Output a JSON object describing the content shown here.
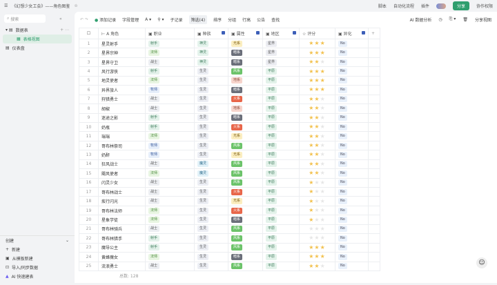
{
  "title": "《幻想少女工会》——角色图鉴",
  "topbar": {
    "script": "脚本",
    "automation": "自动化流程",
    "plugin": "插件",
    "share": "分享",
    "permission": "协作权限"
  },
  "sidebar": {
    "search_placeholder": "搜索",
    "group": "数据表",
    "items": [
      "表格视图",
      "仪表盘"
    ],
    "create": "创建",
    "create_items": [
      "新建",
      "从模板新建",
      "导入/同步数据",
      "AI 快速建表"
    ]
  },
  "toolbar": {
    "add": "添加记录",
    "fields": "字段管理",
    "subrecord": "子记录",
    "filter": "筛选(4)",
    "sort": "排序",
    "group": "分组",
    "row_height": "行高",
    "notice": "公告",
    "find": "查找",
    "ai": "AI 数据分析",
    "share_view": "分享视图"
  },
  "columns": [
    "角色",
    "职业",
    "种族",
    "属性",
    "地区",
    "评分",
    "异化"
  ],
  "colors": {
    "accent": "#2f9e6e",
    "star": "#f2c14e"
  },
  "rows": [
    [
      "星灵射手",
      "射手",
      "神灵",
      "光系",
      "星界",
      3,
      "No"
    ],
    [
      "星界宗神",
      "法师",
      "神灵",
      "暗系",
      "星界",
      3,
      "No"
    ],
    [
      "星界守卫",
      "战士",
      "神灵",
      "暗系",
      "星界",
      2,
      "No"
    ],
    [
      "风行游侠",
      "射手",
      "生灵",
      "风系",
      "平原",
      3,
      "No"
    ],
    [
      "地灵使者",
      "法师",
      "生灵",
      "地系",
      "平原",
      3,
      "No"
    ],
    [
      "异界旅人",
      "牧师",
      "生灵",
      "暗系",
      "平原",
      3,
      "No"
    ],
    [
      "狩猎勇士",
      "战士",
      "生灵",
      "火系",
      "平原",
      2,
      "No"
    ],
    [
      "胡椒",
      "战士",
      "生灵",
      "地系",
      "平原",
      2,
      "No"
    ],
    [
      "迷途之影",
      "射手",
      "生灵",
      "暗系",
      "平原",
      2,
      "No"
    ],
    [
      "奶瓶",
      "射手",
      "生灵",
      "火系",
      "平原",
      2,
      "No"
    ],
    [
      "瑞瑞",
      "法师",
      "生灵",
      "光系",
      "平原",
      2,
      "No"
    ],
    [
      "哥布林祭司",
      "牧师",
      "生灵",
      "风系",
      "平原",
      2,
      "No"
    ],
    [
      "奶酐",
      "牧师",
      "生灵",
      "光系",
      "平原",
      2,
      "No"
    ],
    [
      "狂风战士",
      "战士",
      "魔灵",
      "风系",
      "平原",
      2,
      "No"
    ],
    [
      "飓风使者",
      "法师",
      "魔灵",
      "风系",
      "平原",
      2,
      "No"
    ],
    [
      "闪灵少女",
      "战士",
      "生灵",
      "风系",
      "平原",
      1,
      "No"
    ],
    [
      "哥布林战士",
      "战士",
      "生灵",
      "火系",
      "平原",
      1,
      "No"
    ],
    [
      "疾行闪光",
      "战士",
      "生灵",
      "光系",
      "平原",
      1,
      "No"
    ],
    [
      "哥布林法师",
      "法师",
      "生灵",
      "火系",
      "平原",
      1,
      "No"
    ],
    [
      "星象学徒",
      "法师",
      "生灵",
      "暗系",
      "平原",
      1,
      "No"
    ],
    [
      "哥布林骑兵",
      "战士",
      "生灵",
      "风系",
      "平原",
      0,
      "No"
    ],
    [
      "哥布林猎手",
      "射手",
      "生灵",
      "风系",
      "平原",
      0,
      "No"
    ],
    [
      "魔导公主",
      "射手",
      "生灵",
      "风系",
      "平原",
      3,
      "No"
    ],
    [
      "黄蜂魔女",
      "法师",
      "生灵",
      "暗系",
      "平原",
      3,
      "No"
    ],
    [
      "流浪勇士",
      "战士",
      "生灵",
      "风系",
      "平原",
      2,
      "No"
    ]
  ],
  "footer": "总数: 128"
}
